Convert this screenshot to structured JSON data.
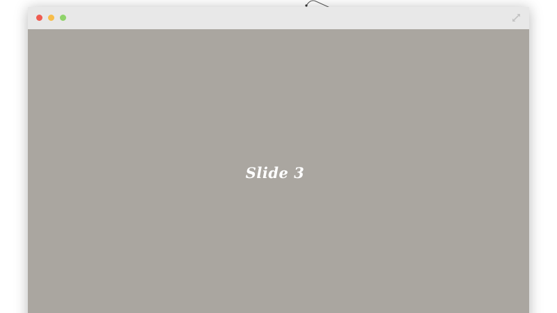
{
  "window": {
    "background_color": "#aaa6a0",
    "titlebar_color": "#e8e8e8",
    "buttons": {
      "close_color": "#ef5b50",
      "minimize_color": "#f7bd4a",
      "zoom_color": "#8fd36a"
    },
    "fullscreen_icon": "expand-arrows-icon"
  },
  "slide": {
    "title": "Slide 3"
  }
}
